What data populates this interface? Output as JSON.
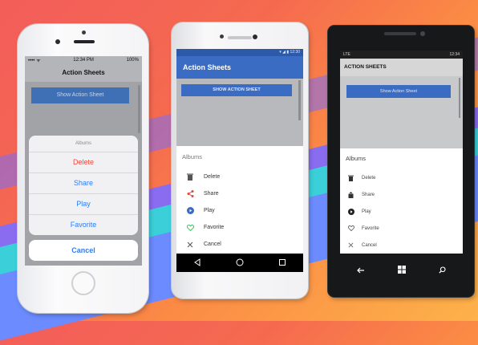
{
  "ios": {
    "status_time": "12:34 PM",
    "status_battery": "100%",
    "title": "Action Sheets",
    "button_label": "Show Action Sheet",
    "sheet_title": "Albums",
    "options": [
      {
        "label": "Delete",
        "style": "destructive"
      },
      {
        "label": "Share",
        "style": "default"
      },
      {
        "label": "Play",
        "style": "default"
      },
      {
        "label": "Favorite",
        "style": "default"
      }
    ],
    "cancel_label": "Cancel",
    "colors": {
      "accent": "#2d7cf6",
      "destructive": "#f2453d",
      "button": "#3f6fb5"
    }
  },
  "android": {
    "status_time": "12:30",
    "title": "Action Sheets",
    "button_label": "SHOW ACTION SHEET",
    "sheet_title": "Albums",
    "options": [
      {
        "label": "Delete",
        "icon": "trash-icon"
      },
      {
        "label": "Share",
        "icon": "share-icon"
      },
      {
        "label": "Play",
        "icon": "play-icon"
      },
      {
        "label": "Favorite",
        "icon": "heart-icon"
      },
      {
        "label": "Cancel",
        "icon": "close-icon"
      }
    ],
    "colors": {
      "appbar": "#3a6cc4",
      "status": "#2c5aa8"
    }
  },
  "windows": {
    "status_left": "LTE",
    "status_time": "12:34",
    "title": "ACTION SHEETS",
    "button_label": "Show Action Sheet",
    "sheet_title": "Albums",
    "options": [
      {
        "label": "Delete",
        "icon": "trash-icon"
      },
      {
        "label": "Share",
        "icon": "share-icon"
      },
      {
        "label": "Play",
        "icon": "play-icon"
      },
      {
        "label": "Favorite",
        "icon": "heart-icon"
      },
      {
        "label": "Cancel",
        "icon": "close-icon"
      }
    ]
  }
}
